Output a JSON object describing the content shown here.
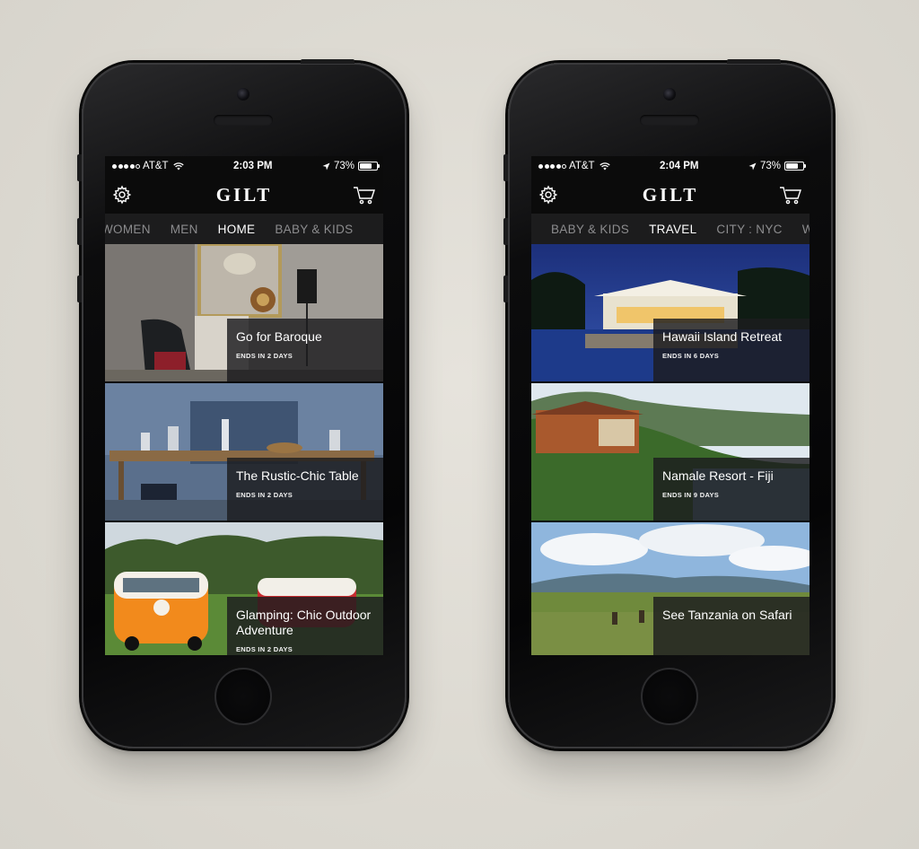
{
  "phones": [
    {
      "status": {
        "carrier": "AT&T",
        "time": "2:03 PM",
        "battery": "73%"
      },
      "logo": "GILT",
      "tabs": [
        "WOMEN",
        "MEN",
        "HOME",
        "BABY & KIDS"
      ],
      "active_tab": "HOME",
      "cards": [
        {
          "title": "Go for Baroque",
          "ends": "ENDS IN 2 DAYS"
        },
        {
          "title": "The Rustic-Chic Table",
          "ends": "ENDS IN 2 DAYS"
        },
        {
          "title": "Glamping: Chic Outdoor Adventure",
          "ends": "ENDS IN 2 DAYS"
        }
      ]
    },
    {
      "status": {
        "carrier": "AT&T",
        "time": "2:04 PM",
        "battery": "73%"
      },
      "logo": "GILT",
      "tabs": [
        "BABY & KIDS",
        "TRAVEL",
        "CITY : NYC",
        "W"
      ],
      "active_tab": "TRAVEL",
      "cards": [
        {
          "title": "Hawaii Island Retreat",
          "ends": "ENDS IN 6 DAYS"
        },
        {
          "title": "Namale Resort - Fiji",
          "ends": "ENDS IN 9 DAYS"
        },
        {
          "title": "See Tanzania on Safari",
          "ends": ""
        }
      ]
    }
  ],
  "icons": {
    "settings": "gear-icon",
    "cart": "cart-icon",
    "location": "location-arrow-icon",
    "wifi": "wifi-icon",
    "battery": "battery-icon"
  },
  "colors": {
    "background": "#dedbd3",
    "screen": "#0b0b0b",
    "tabbar": "#1c1c1d",
    "tab_inactive": "#8c8c8e",
    "tab_active": "#ffffff"
  },
  "battery_level": 0.73
}
